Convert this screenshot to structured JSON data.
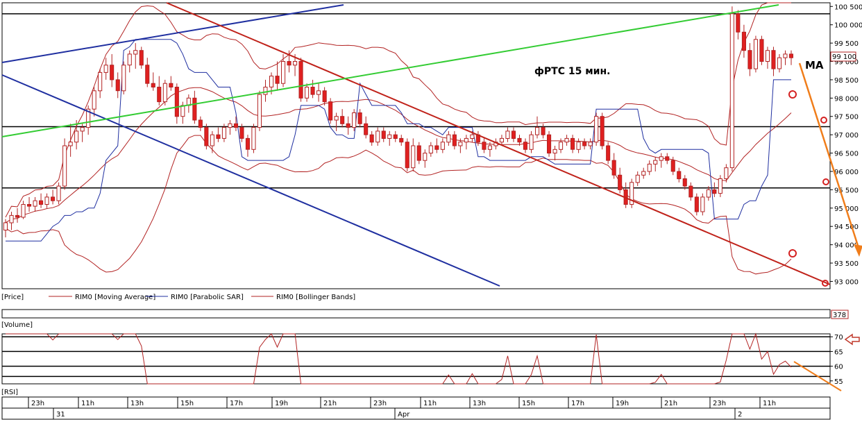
{
  "chart_data": {
    "type": "candlestick",
    "annotation_title": "фРТС  15 мин.",
    "annotation_ma": "MA",
    "price_panel": {
      "ylim": [
        92800,
        100600
      ],
      "y_ticks": [
        "93 000",
        "93 500",
        "94 000",
        "94 500",
        "95 000",
        "95 500",
        "96 000",
        "96 500",
        "97 000",
        "97 500",
        "98 000",
        "98 500",
        "99 000",
        "99 500",
        "100 000",
        "100 500"
      ],
      "last_price_label": "99 100",
      "legend": [
        "[Price]",
        "RIM0 [Moving Average]",
        "RIM0 [Parabolic SAR]",
        "RIM0 [Bollinger Bands]"
      ],
      "horizontal_levels": [
        100300,
        97220,
        95550
      ],
      "candles": [
        [
          94400,
          94700,
          94200,
          94600
        ],
        [
          94600,
          94900,
          94400,
          94800
        ],
        [
          94800,
          95000,
          94600,
          94750
        ],
        [
          94750,
          95200,
          94700,
          95100
        ],
        [
          95100,
          95300,
          94900,
          95050
        ],
        [
          95050,
          95300,
          94900,
          95200
        ],
        [
          95200,
          95400,
          95000,
          95100
        ],
        [
          95100,
          95400,
          95000,
          95300
        ],
        [
          95300,
          95500,
          95100,
          95200
        ],
        [
          95200,
          95700,
          95100,
          95600
        ],
        [
          95600,
          96900,
          95500,
          96700
        ],
        [
          96700,
          97300,
          96400,
          96800
        ],
        [
          96800,
          97400,
          96600,
          97100
        ],
        [
          97100,
          97300,
          96800,
          97200
        ],
        [
          97200,
          97800,
          97000,
          97700
        ],
        [
          97700,
          98300,
          97500,
          98200
        ],
        [
          98200,
          98800,
          98000,
          98700
        ],
        [
          98700,
          99100,
          98500,
          98900
        ],
        [
          98900,
          99200,
          98300,
          98500
        ],
        [
          98500,
          98700,
          98000,
          98200
        ],
        [
          98200,
          99000,
          98100,
          98900
        ],
        [
          98900,
          99300,
          98700,
          99200
        ],
        [
          99200,
          99500,
          98800,
          99300
        ],
        [
          99300,
          99400,
          98800,
          98900
        ],
        [
          98900,
          99100,
          98300,
          98400
        ],
        [
          98400,
          98700,
          98200,
          98300
        ],
        [
          98300,
          98600,
          97800,
          97900
        ],
        [
          97900,
          98500,
          97800,
          98400
        ],
        [
          98400,
          98600,
          98200,
          98300
        ],
        [
          98300,
          98400,
          97300,
          97500
        ],
        [
          97500,
          97900,
          97300,
          97800
        ],
        [
          97800,
          98100,
          97600,
          98000
        ],
        [
          98000,
          98200,
          97300,
          97400
        ],
        [
          97400,
          97500,
          97100,
          97200
        ],
        [
          97200,
          97300,
          96600,
          96700
        ],
        [
          96700,
          97100,
          96500,
          97000
        ],
        [
          97000,
          97200,
          96800,
          96900
        ],
        [
          96900,
          97300,
          96800,
          97200
        ],
        [
          97200,
          97400,
          97000,
          97300
        ],
        [
          97300,
          97500,
          97100,
          97200
        ],
        [
          97200,
          97300,
          96800,
          96900
        ],
        [
          96900,
          97000,
          96400,
          96600
        ],
        [
          96600,
          97300,
          96500,
          97200
        ],
        [
          97200,
          98200,
          97100,
          98100
        ],
        [
          98100,
          98500,
          97900,
          98300
        ],
        [
          98300,
          98700,
          98100,
          98600
        ],
        [
          98600,
          99000,
          98200,
          98400
        ],
        [
          98400,
          99200,
          98300,
          99000
        ],
        [
          99000,
          99300,
          98700,
          98900
        ],
        [
          98900,
          99200,
          98600,
          99000
        ],
        [
          99000,
          99100,
          97900,
          98000
        ],
        [
          98000,
          98400,
          97900,
          98300
        ],
        [
          98300,
          98500,
          98000,
          98100
        ],
        [
          98100,
          98400,
          97900,
          98200
        ],
        [
          98200,
          98300,
          97800,
          97900
        ],
        [
          97900,
          98000,
          97300,
          97400
        ],
        [
          97400,
          97600,
          97100,
          97500
        ],
        [
          97500,
          97700,
          97200,
          97300
        ],
        [
          97300,
          97500,
          97000,
          97200
        ],
        [
          97200,
          97700,
          97100,
          97600
        ],
        [
          97600,
          97700,
          97200,
          97300
        ],
        [
          97300,
          97500,
          96900,
          97000
        ],
        [
          97000,
          97100,
          96700,
          96800
        ],
        [
          96800,
          97200,
          96700,
          97100
        ],
        [
          97100,
          97200,
          96800,
          96900
        ],
        [
          96900,
          97100,
          96700,
          97000
        ],
        [
          97000,
          97100,
          96800,
          96900
        ],
        [
          96900,
          97000,
          96700,
          96800
        ],
        [
          96800,
          96900,
          96000,
          96100
        ],
        [
          96100,
          96900,
          96000,
          96700
        ],
        [
          96700,
          96800,
          96200,
          96300
        ],
        [
          96300,
          96600,
          96100,
          96500
        ],
        [
          96500,
          96800,
          96400,
          96700
        ],
        [
          96700,
          96900,
          96500,
          96600
        ],
        [
          96600,
          96900,
          96500,
          96800
        ],
        [
          96800,
          97100,
          96700,
          97000
        ],
        [
          97000,
          97100,
          96600,
          96700
        ],
        [
          96700,
          96900,
          96500,
          96800
        ],
        [
          96800,
          97000,
          96600,
          96900
        ],
        [
          96900,
          97100,
          96800,
          97000
        ],
        [
          97000,
          97100,
          96700,
          96800
        ],
        [
          96800,
          96900,
          96500,
          96600
        ],
        [
          96600,
          96800,
          96400,
          96700
        ],
        [
          96700,
          96900,
          96600,
          96800
        ],
        [
          96800,
          97000,
          96700,
          96900
        ],
        [
          96900,
          97200,
          96800,
          97100
        ],
        [
          97100,
          97200,
          96800,
          96900
        ],
        [
          96900,
          97000,
          96700,
          96800
        ],
        [
          96800,
          96900,
          96500,
          96600
        ],
        [
          96600,
          97100,
          96500,
          97000
        ],
        [
          97000,
          97500,
          96900,
          97200
        ],
        [
          97200,
          97300,
          96900,
          97000
        ],
        [
          97000,
          97100,
          96400,
          96500
        ],
        [
          96500,
          96700,
          96300,
          96600
        ],
        [
          96600,
          96900,
          96500,
          96800
        ],
        [
          96800,
          97000,
          96700,
          96900
        ],
        [
          96900,
          97000,
          96500,
          96600
        ],
        [
          96600,
          96900,
          96500,
          96800
        ],
        [
          96800,
          96900,
          96600,
          96700
        ],
        [
          96700,
          96900,
          96600,
          96800
        ],
        [
          96800,
          97600,
          96700,
          97500
        ],
        [
          97500,
          97600,
          96600,
          96700
        ],
        [
          96700,
          96800,
          96200,
          96300
        ],
        [
          96300,
          96500,
          95800,
          95900
        ],
        [
          95900,
          96100,
          95400,
          95500
        ],
        [
          95500,
          95700,
          95000,
          95100
        ],
        [
          95100,
          95800,
          95000,
          95700
        ],
        [
          95700,
          96000,
          95600,
          95900
        ],
        [
          95900,
          96100,
          95800,
          96000
        ],
        [
          96000,
          96300,
          95900,
          96200
        ],
        [
          96200,
          96400,
          96000,
          96300
        ],
        [
          96300,
          96500,
          96100,
          96400
        ],
        [
          96400,
          96500,
          96200,
          96300
        ],
        [
          96300,
          96400,
          95900,
          96000
        ],
        [
          96000,
          96100,
          95700,
          95800
        ],
        [
          95800,
          95900,
          95500,
          95600
        ],
        [
          95600,
          95700,
          95200,
          95300
        ],
        [
          95300,
          95400,
          94800,
          94900
        ],
        [
          94900,
          95400,
          94800,
          95300
        ],
        [
          95300,
          95600,
          95200,
          95500
        ],
        [
          95500,
          95700,
          95300,
          95400
        ],
        [
          95400,
          95900,
          95300,
          95800
        ],
        [
          95800,
          96200,
          95700,
          96100
        ],
        [
          96100,
          100500,
          96000,
          100300
        ],
        [
          100300,
          100400,
          99600,
          99800
        ],
        [
          99800,
          100000,
          99100,
          99300
        ],
        [
          99300,
          99500,
          98600,
          98800
        ],
        [
          98800,
          99700,
          98700,
          99600
        ],
        [
          99600,
          99700,
          98900,
          99000
        ],
        [
          99000,
          99400,
          98800,
          99300
        ],
        [
          99300,
          99400,
          98600,
          98800
        ],
        [
          98800,
          99200,
          98700,
          99100
        ],
        [
          99100,
          99300,
          98900,
          99200
        ],
        [
          99200,
          99300,
          98900,
          99100
        ]
      ]
    },
    "volume_panel": {
      "label": "[Volume]",
      "value_label": "378"
    },
    "rsi_panel": {
      "label": "[RSI]",
      "ylim": [
        54,
        71
      ],
      "y_ticks": [
        "55",
        "60",
        "65",
        "70"
      ],
      "levels": [
        70,
        65,
        60,
        56.5
      ]
    },
    "time_axis": {
      "hour_labels": [
        "23h",
        "11h",
        "13h",
        "15h",
        "17h",
        "19h",
        "21h",
        "23h",
        "11h",
        "13h",
        "15h",
        "17h",
        "19h",
        "21h",
        "23h",
        "11h"
      ],
      "date_labels": [
        "31",
        "Apr",
        "2"
      ]
    }
  }
}
